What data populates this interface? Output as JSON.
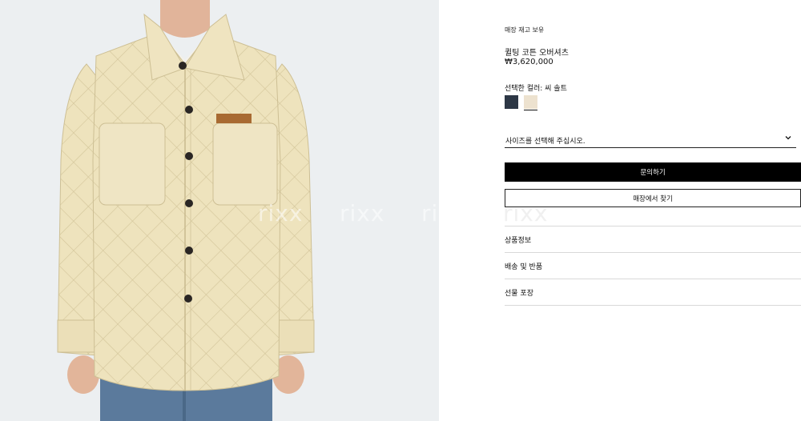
{
  "watermark": {
    "text": "rixx"
  },
  "product": {
    "stock_status": "매장 재고 보유",
    "name": "퀼팅 코튼 오버셔츠",
    "price": "₩3,620,000",
    "selected_color_label": "선택한 컬러: 씨 솔트",
    "swatches": [
      {
        "icon": "color-swatch-navy",
        "color": "#2d3745"
      },
      {
        "icon": "color-swatch-cream",
        "color": "#ede2cf",
        "selected": true
      }
    ],
    "size_select_placeholder": "사이즈를 선택해 주십시오.",
    "inquire_button": "문의하기",
    "find_store_button": "매장에서 찾기"
  },
  "accordion": {
    "items": [
      {
        "label": "상품정보"
      },
      {
        "label": "배송 및 반품"
      },
      {
        "label": "선물 포장"
      }
    ]
  }
}
